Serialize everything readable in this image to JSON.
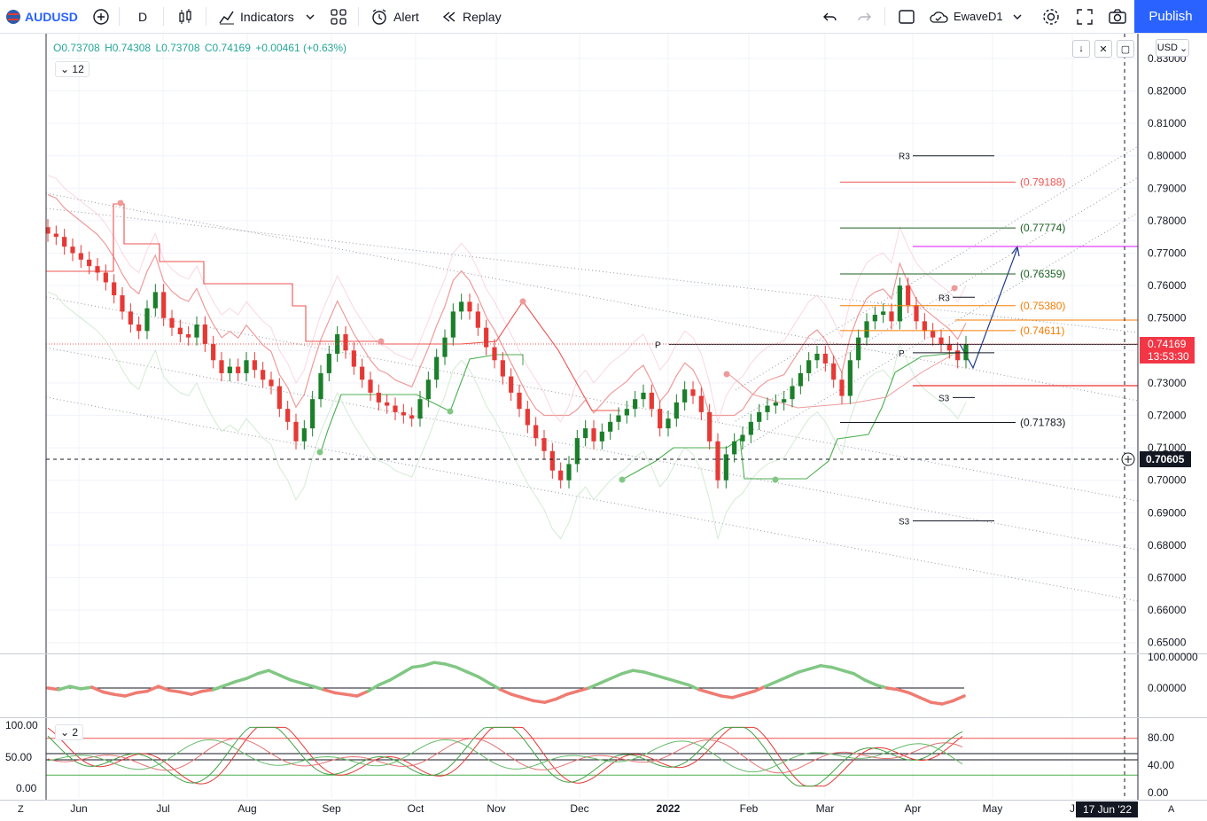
{
  "toolbar": {
    "symbol": "AUDUSD",
    "interval": "D",
    "indicators": "Indicators",
    "alert": "Alert",
    "replay": "Replay",
    "layout_name": "EwaveD1",
    "publish": "Publish"
  },
  "legend": {
    "open": "O0.73708",
    "high": "H0.74308",
    "low": "L0.73708",
    "close": "C0.74169",
    "change": "+0.00461 (+0.63%)",
    "indicator_count": "12",
    "stoch_count": "2"
  },
  "currency": "USD",
  "price_axis": {
    "current_price": "0.74169",
    "countdown": "13:53:30",
    "crosshair_price": "0.70605",
    "crosshair_date": "17 Jun '22"
  },
  "bottom_bar": {
    "left": "Z",
    "right": "A"
  },
  "colors": {
    "up": "#26a69a",
    "down": "#ef5350",
    "bull_candle": "#1b7f2a",
    "bear_candle": "#e53935",
    "accent": "#2962ff"
  },
  "chart_data": {
    "type": "line",
    "main": {
      "y_ticks": [
        "0.83000",
        "0.82000",
        "0.81000",
        "0.80000",
        "0.79000",
        "0.78000",
        "0.77000",
        "0.76000",
        "0.75000",
        "0.74000",
        "0.73000",
        "0.72000",
        "0.71000",
        "0.70000",
        "0.69000",
        "0.68000",
        "0.67000",
        "0.66000",
        "0.65000"
      ],
      "ylim": [
        0.646,
        0.832
      ],
      "fib_levels": [
        {
          "label": "(0.79188)",
          "value": 0.79188,
          "color": "#ef5350"
        },
        {
          "label": "(0.77774)",
          "value": 0.77774,
          "color": "#1b5e20"
        },
        {
          "label": "(0.76359)",
          "value": 0.76359,
          "color": "#1b5e20"
        },
        {
          "label": "(0.75380)",
          "value": 0.7538,
          "color": "#f57c00"
        },
        {
          "label": "(0.74611)",
          "value": 0.74611,
          "color": "#f57c00"
        },
        {
          "label": "(0.71783)",
          "value": 0.71783,
          "color": "#131722"
        }
      ],
      "pivots": [
        {
          "label": "R3",
          "value": 0.8
        },
        {
          "label": "R3",
          "value": 0.7564
        },
        {
          "label": "P",
          "value": 0.7419
        },
        {
          "label": "P",
          "value": 0.7393
        },
        {
          "label": "S3",
          "value": 0.7255
        },
        {
          "label": "S3",
          "value": 0.6875
        }
      ],
      "close_series": [
        0.776,
        0.775,
        0.772,
        0.77,
        0.768,
        0.766,
        0.764,
        0.761,
        0.757,
        0.752,
        0.748,
        0.746,
        0.753,
        0.758,
        0.75,
        0.747,
        0.745,
        0.744,
        0.748,
        0.742,
        0.737,
        0.733,
        0.735,
        0.733,
        0.737,
        0.734,
        0.731,
        0.729,
        0.722,
        0.718,
        0.712,
        0.716,
        0.725,
        0.733,
        0.739,
        0.745,
        0.74,
        0.735,
        0.731,
        0.727,
        0.724,
        0.723,
        0.721,
        0.72,
        0.719,
        0.725,
        0.731,
        0.738,
        0.744,
        0.752,
        0.755,
        0.752,
        0.747,
        0.741,
        0.737,
        0.732,
        0.727,
        0.722,
        0.717,
        0.713,
        0.709,
        0.703,
        0.7,
        0.705,
        0.713,
        0.716,
        0.712,
        0.715,
        0.718,
        0.72,
        0.722,
        0.725,
        0.727,
        0.722,
        0.716,
        0.719,
        0.724,
        0.728,
        0.726,
        0.721,
        0.712,
        0.7,
        0.708,
        0.712,
        0.714,
        0.718,
        0.721,
        0.723,
        0.724,
        0.725,
        0.729,
        0.733,
        0.737,
        0.739,
        0.736,
        0.731,
        0.726,
        0.737,
        0.744,
        0.749,
        0.751,
        0.752,
        0.749,
        0.76,
        0.754,
        0.749,
        0.746,
        0.744,
        0.742,
        0.74,
        0.737,
        0.742
      ],
      "candle_date_range": [
        "Jun",
        "Apr"
      ]
    },
    "x_ticks": [
      "Jun",
      "Jul",
      "Aug",
      "Sep",
      "Oct",
      "Nov",
      "Dec",
      "2022",
      "Feb",
      "Mar",
      "Apr",
      "May",
      "J"
    ],
    "oscillator": {
      "y_ticks": [
        "100.00000",
        "0.00000"
      ],
      "values": [
        0,
        -2,
        2,
        -1,
        1,
        -5,
        -8,
        -10,
        -6,
        -4,
        2,
        -3,
        -5,
        -8,
        -4,
        -2,
        3,
        8,
        12,
        18,
        22,
        16,
        10,
        6,
        2,
        -2,
        -6,
        -8,
        -10,
        -4,
        4,
        10,
        18,
        26,
        28,
        32,
        30,
        26,
        20,
        14,
        6,
        -2,
        -8,
        -12,
        -16,
        -18,
        -14,
        -8,
        -4,
        0,
        6,
        12,
        18,
        22,
        20,
        16,
        12,
        8,
        4,
        -2,
        -6,
        -10,
        -12,
        -8,
        -4,
        2,
        8,
        14,
        20,
        24,
        28,
        26,
        22,
        18,
        10,
        4,
        0,
        -2,
        -6,
        -12,
        -18,
        -20,
        -16,
        -10
      ]
    },
    "stochastic": {
      "y_ticks": [
        "100.00",
        "50.00",
        "0.00"
      ],
      "right_ticks": [
        "80.00",
        "40.00",
        "0.00"
      ],
      "levels": [
        80,
        45,
        20
      ]
    }
  }
}
